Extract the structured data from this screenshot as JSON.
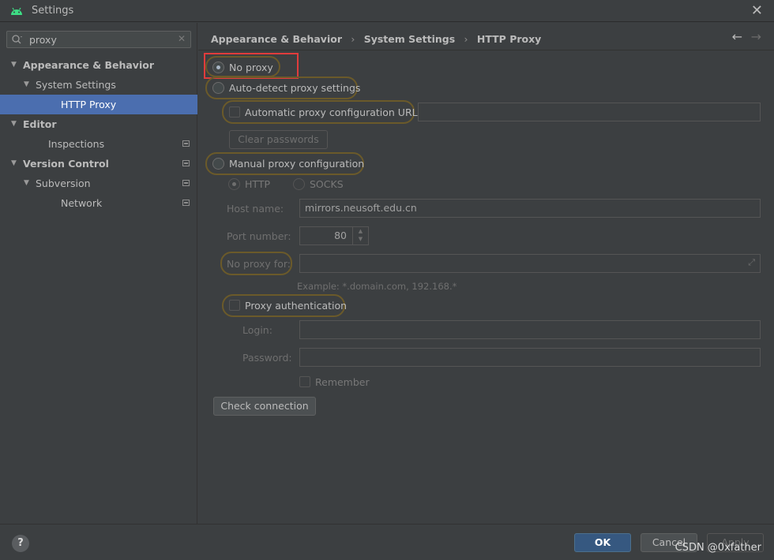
{
  "window": {
    "title": "Settings",
    "app_icon": "android-icon",
    "close_icon": "close-icon"
  },
  "sidebar": {
    "search": {
      "value": "proxy",
      "icon": "search-icon"
    },
    "tree": [
      {
        "label": "Appearance & Behavior",
        "level": 0,
        "bold": true,
        "expanded": true,
        "project_icon": false,
        "selected": false
      },
      {
        "label": "System Settings",
        "level": 1,
        "bold": false,
        "expanded": true,
        "project_icon": false,
        "selected": false
      },
      {
        "label": "HTTP Proxy",
        "level": 2,
        "bold": false,
        "expanded": false,
        "project_icon": false,
        "selected": true
      },
      {
        "label": "Editor",
        "level": 0,
        "bold": true,
        "expanded": true,
        "project_icon": false,
        "selected": false
      },
      {
        "label": "Inspections",
        "level": 1,
        "bold": false,
        "expanded": false,
        "project_icon": true,
        "selected": false
      },
      {
        "label": "Version Control",
        "level": 0,
        "bold": true,
        "expanded": true,
        "project_icon": true,
        "selected": false
      },
      {
        "label": "Subversion",
        "level": 1,
        "bold": false,
        "expanded": true,
        "project_icon": true,
        "selected": false
      },
      {
        "label": "Network",
        "level": 2,
        "bold": false,
        "expanded": false,
        "project_icon": true,
        "selected": false
      }
    ]
  },
  "breadcrumb": {
    "items": [
      "Appearance & Behavior",
      "System Settings",
      "HTTP Proxy"
    ],
    "sep": "›"
  },
  "proxy": {
    "no_proxy_label": "No proxy",
    "auto_detect_label": "Auto-detect proxy settings",
    "auto_config_url_label": "Automatic proxy configuration URL:",
    "auto_config_url_value": "",
    "clear_passwords_label": "Clear passwords",
    "manual_label": "Manual proxy configuration",
    "http_label": "HTTP",
    "socks_label": "SOCKS",
    "host_label": "Host name:",
    "host_value": "mirrors.neusoft.edu.cn",
    "port_label": "Port number:",
    "port_value": "80",
    "no_proxy_for_label": "No proxy for:",
    "no_proxy_for_value": "",
    "example_text": "Example: *.domain.com, 192.168.*",
    "proxy_auth_label": "Proxy authentication",
    "login_label": "Login:",
    "password_label": "Password:",
    "remember_label": "Remember",
    "check_connection_label": "Check connection",
    "selected_mode": "No proxy"
  },
  "footer": {
    "help_label": "?",
    "ok_label": "OK",
    "cancel_label": "Cancel",
    "apply_label": "Apply",
    "watermark": "CSDN @0xfather"
  },
  "colors": {
    "accent": "#4b6eaf",
    "highlight_outline": "#6b5a2a",
    "red_outline": "#e03c3c",
    "ok_button": "#365880"
  }
}
